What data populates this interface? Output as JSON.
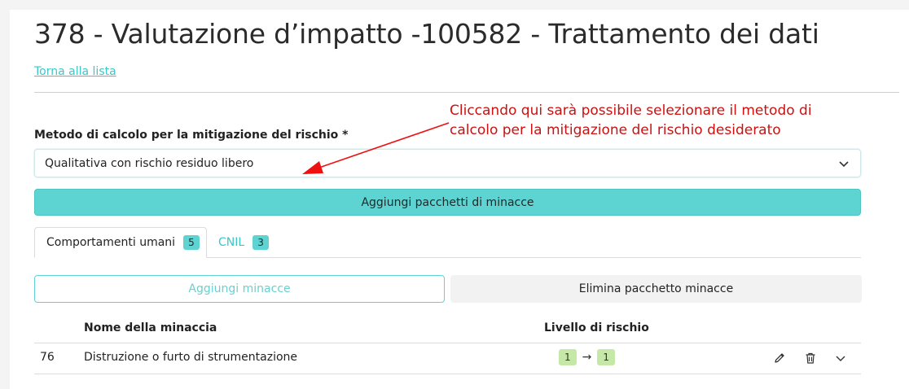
{
  "page": {
    "title": "378 - Valutazione d’impatto -100582 - Trattamento dei dati",
    "back_link": "Torna alla lista"
  },
  "annotation": {
    "line1": "Cliccando qui sarà possibile selezionare il metodo di",
    "line2": "calcolo per la mitigazione del rischio desiderato",
    "color": "#cc1111"
  },
  "form": {
    "method_label": "Metodo di calcolo per la mitigazione del rischio *",
    "method_value": "Qualitativa con rischio residuo libero",
    "add_packages_button": "Aggiungi pacchetti di minacce"
  },
  "tabs": [
    {
      "label": "Comportamenti umani",
      "count": "5",
      "active": true
    },
    {
      "label": "CNIL",
      "count": "3",
      "active": false
    }
  ],
  "actions": {
    "add_threats": "Aggiungi minacce",
    "delete_package": "Elimina pacchetto minacce"
  },
  "table": {
    "headers": {
      "name": "Nome della minaccia",
      "risk": "Livello di rischio"
    },
    "rows": [
      {
        "id": "76",
        "name": "Distruzione o furto di strumentazione",
        "risk_from": "1",
        "risk_arrow": "→",
        "risk_to": "1"
      }
    ]
  },
  "icons": {
    "select_chevron": "chevron-down-icon",
    "edit": "pencil-icon",
    "delete": "trash-icon",
    "expand": "chevron-down-icon"
  },
  "colors": {
    "accent": "#5dd4d2",
    "link": "#3cc6c6",
    "risk_low": "#c6e8a6"
  }
}
